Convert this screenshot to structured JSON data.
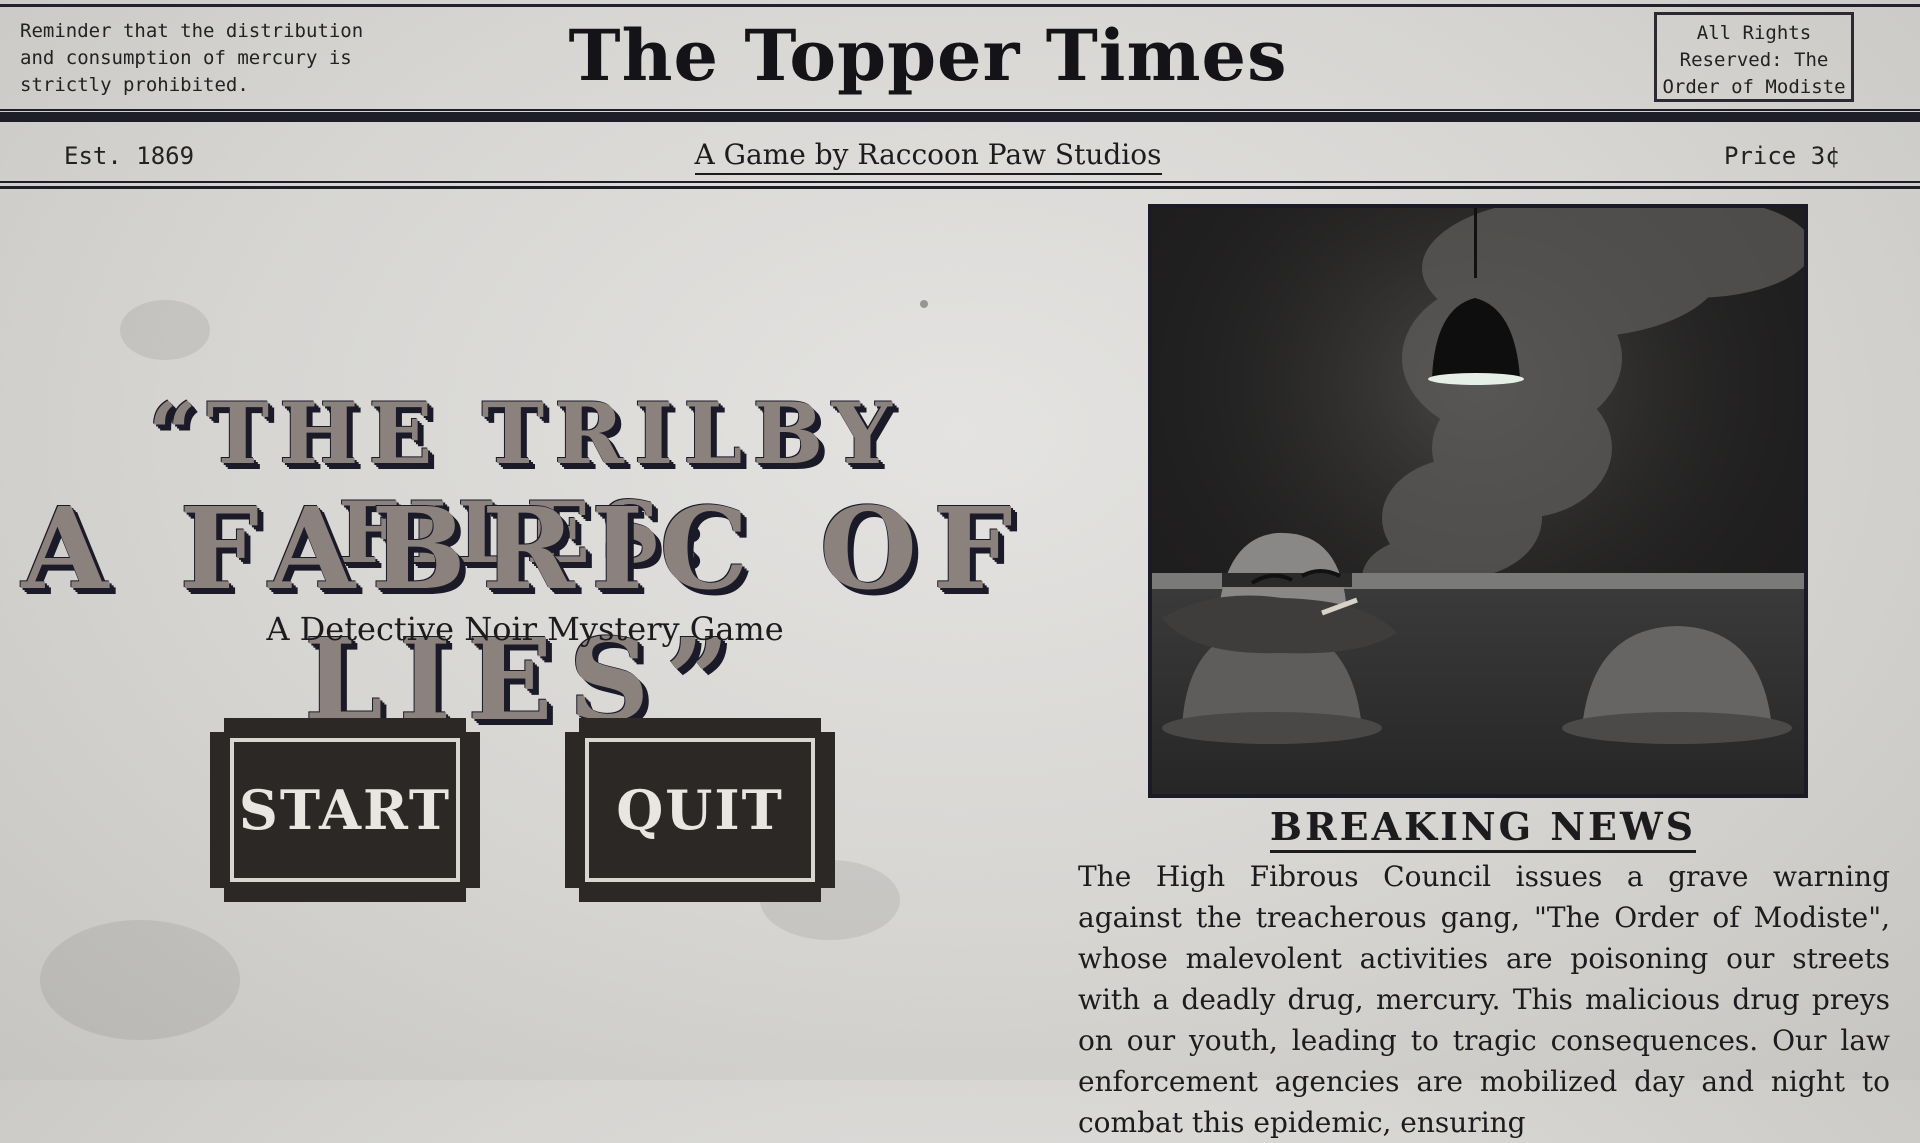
{
  "masthead": {
    "reminder": "Reminder that the distribution and consumption of mercury is strictly prohibited.",
    "title": "The Topper Times",
    "rights": "All Rights Reserved: The Order of Modiste",
    "established": "Est. 1869",
    "byline": "A Game by Raccoon Paw Studios",
    "price": "Price 3¢"
  },
  "game": {
    "title_line1": "“THE TRILBY FILES:",
    "title_line2": "A FABRIC OF LIES”",
    "tagline": "A Detective Noir Mystery Game"
  },
  "menu": {
    "start_label": "START",
    "quit_label": "QUIT"
  },
  "illustration": {
    "subject": "detective hat character smoking under hanging lamp"
  },
  "news": {
    "heading": "BREAKING NEWS",
    "body": "The High Fibrous Council issues a grave warning against the treacherous gang, \"The Order of Modiste\", whose malevolent activities are poisoning our streets with a deadly drug, mercury. This malicious drug preys on our youth, leading to tragic consequences. Our law enforcement agencies are mobilized day and night to combat this epidemic, ensuring"
  },
  "colors": {
    "paper": "#d9d8d5",
    "ink": "#1c1b1d",
    "title_fill": "#8c827d",
    "button_fill": "#2c2826"
  }
}
